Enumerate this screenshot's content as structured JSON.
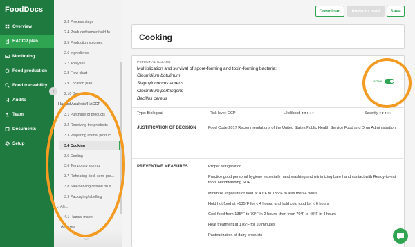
{
  "app": {
    "logo": "FoodDocs",
    "nav": [
      {
        "label": "Overview",
        "icon": "overview-icon"
      },
      {
        "label": "HACCP plan",
        "icon": "document-icon",
        "active": true
      },
      {
        "label": "Monitoring",
        "icon": "monitoring-icon"
      },
      {
        "label": "Food production",
        "icon": "food-production-icon"
      },
      {
        "label": "Food traceability",
        "icon": "traceability-icon"
      },
      {
        "label": "Audits",
        "icon": "audits-icon"
      },
      {
        "label": "Team",
        "icon": "team-icon"
      },
      {
        "label": "Documents",
        "icon": "documents-icon"
      },
      {
        "label": "Setup",
        "icon": "gear-icon"
      }
    ]
  },
  "submenu": {
    "items_top": [
      "2.3 Process steps",
      "2.4 Produced/served/sold fo...",
      "2.5 Production volumes",
      "2.6 Ingredients",
      "2.7 Analyses",
      "2.8 Flow chart",
      "2.9 Location plan",
      "2.10 Dec..."
    ],
    "section": "Hazard Analysis/HACCP",
    "items_hazard": [
      "3.1 Purchase of products",
      "3.2 Receiving the products",
      "3.3 Preparing animal product...",
      "3.4 Cooking",
      "3.5 Cooling",
      "3.6 Temporary storing",
      "3.7 Reheating (incl. semi-pre...",
      "3.8 Sale/serving of food on s...",
      "3.9 Packaging/labelling"
    ],
    "section2": "An...",
    "items_after": [
      "4.1 Hazard matrix",
      "Annexes"
    ]
  },
  "toolbar": {
    "download_label": "Download",
    "invite_label": "Invite to read",
    "save_label": "Save"
  },
  "page": {
    "title": "Cooking"
  },
  "hazard": {
    "label": "POTENTIAL HAZARD",
    "title": "Multiplication and survival of spore-forming and toxin-forming bacteria:",
    "organisms": [
      "Clostridium botulinum",
      "Staphylococcus aureus",
      "Clostridium perfringens",
      "Bacillus cereus"
    ],
    "status_label": "Active",
    "type_text": "Type: Biological",
    "risk_text": "Risk level:  CCP",
    "likelihood_label": "Likelihood",
    "likelihood_dots": "●●●○○",
    "severity_label": "Severity",
    "severity_dots": "●●●○○",
    "justification_heading": "JUSTIFICATION OF DECISION",
    "justification_text": "Food Code 2017 Recommendations of the United States Public Health Service Food and Drug Administration",
    "preventive_heading": "PREVENTIVE MEASURES",
    "measures": [
      "Proper refrigeration",
      "Practice good personal hygiene especially hand washing and minimizing bare hand contact with Ready-to-eat food, Handwashing SOP.",
      "Minimize exposure of food at 40°F to 135°F to less than 4 hours",
      "Hold hot food at >135°F for < 4 hours, and hold cold food for < 6 hours",
      "Cool food from 135°F to 70°F in 2 hours, then from 70°F to 40°F in 4 hours",
      "Heat treatment at 176°F for 10 minutes",
      "Pasteurization of dairy products"
    ]
  },
  "colors": {
    "brand_dark": "#1f7a3f",
    "brand": "#2fa552",
    "annotation": "#f39a21"
  }
}
